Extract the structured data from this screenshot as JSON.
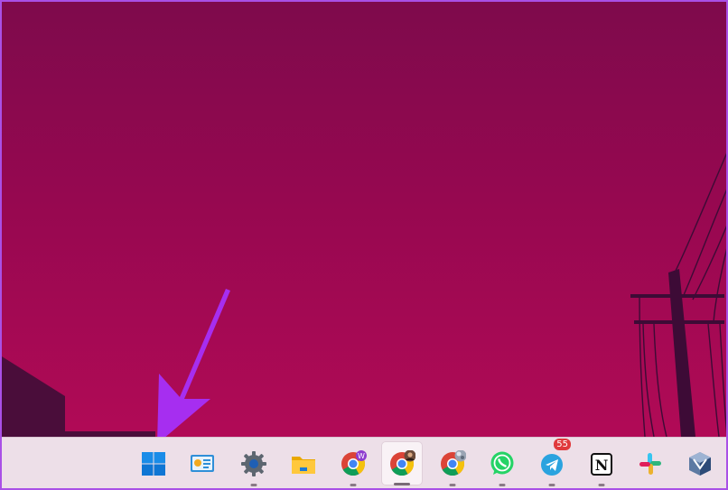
{
  "desktop": {
    "wallpaper_top_color": "#7e0a4c",
    "wallpaper_bottom_color": "#b10a56",
    "annotation_arrow_color": "#a62ef0"
  },
  "taskbar": {
    "background": "#eddfe8",
    "items": [
      {
        "name": "start",
        "icon": "windows-start-icon",
        "running": false
      },
      {
        "name": "widgets",
        "icon": "widgets-icon",
        "running": false
      },
      {
        "name": "settings",
        "icon": "settings-gear-icon",
        "running": true
      },
      {
        "name": "file-explorer",
        "icon": "folder-icon",
        "running": false
      },
      {
        "name": "chrome-profile-w",
        "icon": "chrome-icon",
        "running": true
      },
      {
        "name": "chrome-profile-photo",
        "icon": "chrome-icon",
        "running": true,
        "active": true
      },
      {
        "name": "chrome-profile-globe",
        "icon": "chrome-icon",
        "running": true
      },
      {
        "name": "whatsapp",
        "icon": "whatsapp-icon",
        "running": true
      },
      {
        "name": "telegram",
        "icon": "telegram-icon",
        "running": true,
        "badge": "55"
      },
      {
        "name": "notion",
        "icon": "notion-icon",
        "running": true
      },
      {
        "name": "slack",
        "icon": "slack-icon",
        "running": false
      },
      {
        "name": "virtualbox",
        "icon": "virtualbox-icon",
        "running": false
      }
    ],
    "chrome_w_profile_letter": "W",
    "notion_letter": "N"
  }
}
